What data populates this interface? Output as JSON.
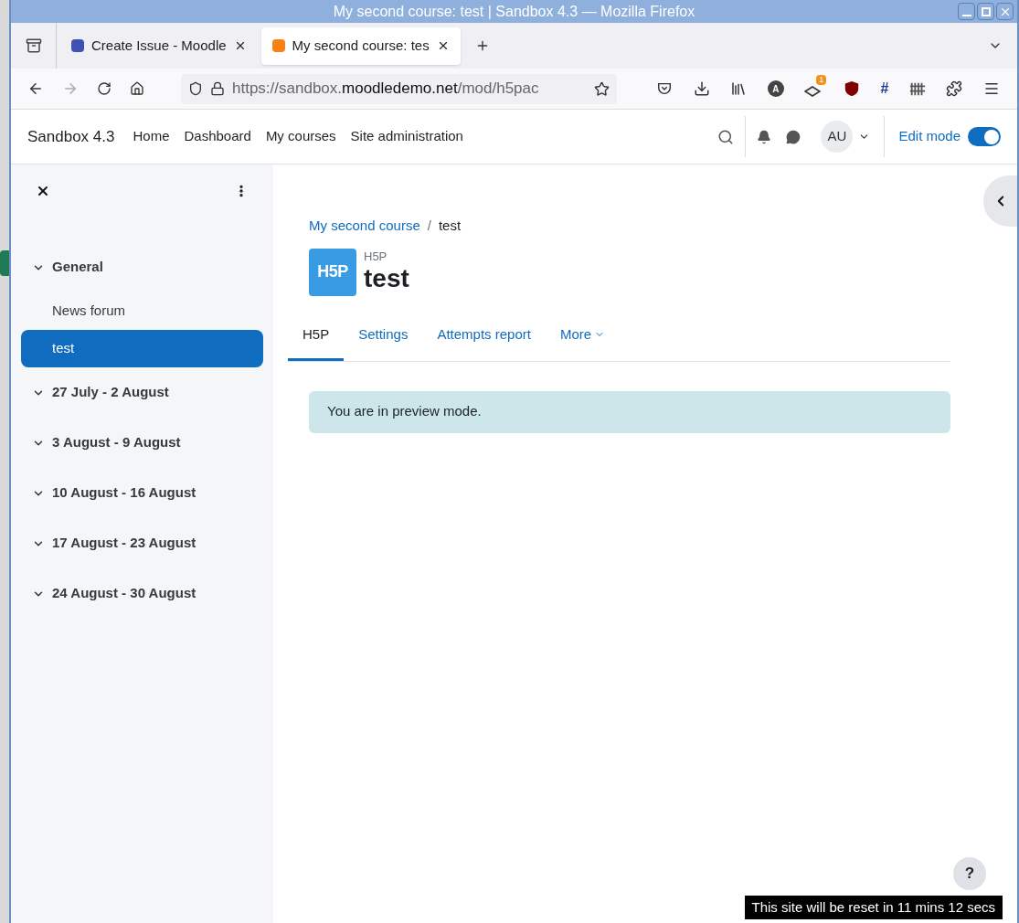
{
  "window": {
    "title": "My second course: test | Sandbox 4.3 — Mozilla Firefox"
  },
  "browser_tabs": [
    {
      "title": "Create Issue - Moodle",
      "selected": false
    },
    {
      "title": "My second course: tes",
      "selected": true
    }
  ],
  "address_bar": {
    "host_prefix": "https://sandbox.",
    "host": "moodledemo.net",
    "path": "/mod/h5pac"
  },
  "toolbar": [
    {
      "kind": "pocket"
    },
    {
      "kind": "download"
    },
    {
      "kind": "library"
    },
    {
      "kind": "letter",
      "label": "A"
    },
    {
      "kind": "badge",
      "label": "1"
    },
    {
      "kind": "shield"
    },
    {
      "kind": "letter-plain",
      "label": "#"
    },
    {
      "kind": "fence"
    },
    {
      "kind": "puzzle"
    },
    {
      "kind": "menu"
    }
  ],
  "site": {
    "name": "Sandbox 4.3",
    "nav": [
      "Home",
      "Dashboard",
      "My courses",
      "Site administration"
    ],
    "avatar": "AU",
    "edit_mode": {
      "label": "Edit mode",
      "on": true
    }
  },
  "sidebar": {
    "sections": [
      {
        "title": "General",
        "expanded": true,
        "children": [
          {
            "label": "News forum",
            "selected": false
          },
          {
            "label": "test",
            "selected": true
          }
        ]
      },
      {
        "title": "27 July - 2 August",
        "expanded": true
      },
      {
        "title": "3 August - 9 August",
        "expanded": true
      },
      {
        "title": "10 August - 16 August",
        "expanded": true
      },
      {
        "title": "17 August - 23 August",
        "expanded": true
      },
      {
        "title": "24 August - 30 August",
        "expanded": true
      }
    ]
  },
  "breadcrumb": [
    "My second course",
    "test"
  ],
  "breadcrumb_separator": "/",
  "activity": {
    "logo_text": "H5P",
    "type": "H5P",
    "title": "test"
  },
  "tabs": [
    {
      "label": "H5P",
      "selected": true
    },
    {
      "label": "Settings",
      "selected": false
    },
    {
      "label": "Attempts report",
      "selected": false
    },
    {
      "label": "More",
      "selected": false
    }
  ],
  "alert": "You are in preview mode.",
  "help_button": "?",
  "reset_notice": "This site will be reset in 11 mins 12 secs"
}
